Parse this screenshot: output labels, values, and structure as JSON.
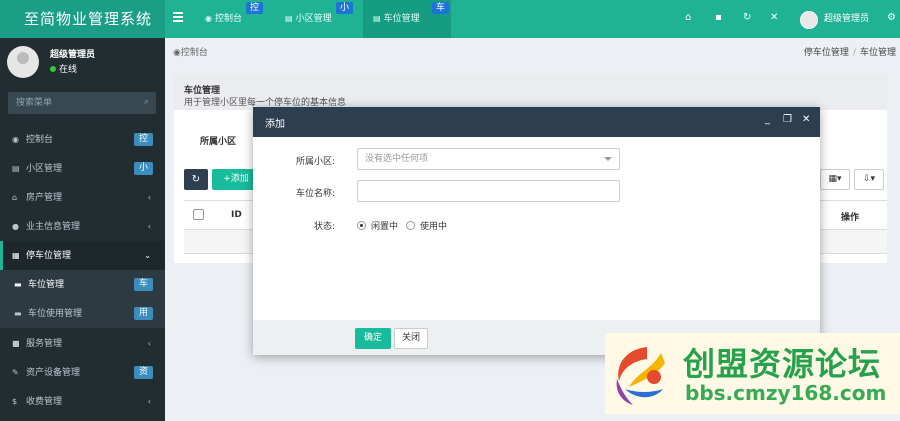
{
  "app": {
    "title": "至简物业管理系统"
  },
  "topbar": {
    "tabs": [
      {
        "label": "控制台",
        "badge": "控"
      },
      {
        "label": "小区管理",
        "badge": "小"
      },
      {
        "label": "车位管理",
        "badge": "车",
        "active": true
      }
    ],
    "user_name": "超级管理员"
  },
  "sidebar": {
    "user": {
      "name": "超级管理员",
      "status": "在线"
    },
    "search_placeholder": "搜索菜单",
    "items": [
      {
        "label": "控制台",
        "badge": "控",
        "icon": "dashboard-icon"
      },
      {
        "label": "小区管理",
        "badge": "小",
        "icon": "list-icon"
      },
      {
        "label": "房产管理",
        "icon": "home-icon"
      },
      {
        "label": "业主信息管理",
        "icon": "user-icon"
      },
      {
        "label": "停车位管理",
        "icon": "parking-icon",
        "open": true
      },
      {
        "label": "车位管理",
        "badge": "车",
        "icon": "list-icon",
        "sub": true,
        "active": true
      },
      {
        "label": "车位使用管理",
        "badge": "用",
        "icon": "list-icon",
        "sub": true
      },
      {
        "label": "服务管理",
        "icon": "book-icon"
      },
      {
        "label": "资产设备管理",
        "badge": "资",
        "icon": "wrench-icon"
      },
      {
        "label": "收费管理",
        "icon": "dollar-icon"
      }
    ]
  },
  "breadcrumb": {
    "left": "控制台",
    "items": [
      "停车位管理",
      "车位管理"
    ]
  },
  "panel": {
    "title": "车位管理",
    "description": "用于管理小区里每一个停车位的基本信息",
    "tab": "所属小区",
    "add_label": "添加",
    "columns": {
      "id": "ID",
      "ops": "操作"
    }
  },
  "modal": {
    "title": "添加",
    "fields": {
      "community_label": "所属小区:",
      "community_placeholder": "没有选中任何项",
      "name_label": "车位名称:",
      "status_label": "状态:",
      "status_options": [
        "闲置中",
        "使用中"
      ],
      "status_selected": "闲置中"
    },
    "ok_label": "确定",
    "close_label": "关闭"
  },
  "watermark": {
    "text": "创盟资源论坛",
    "url": "bbs.cmzy168.com"
  },
  "colors": {
    "brand": "#1fb394",
    "sidebar": "#222d32",
    "badge": "#3c8dbc",
    "modal_header": "#2c3e50",
    "success": "#18bc9c"
  }
}
